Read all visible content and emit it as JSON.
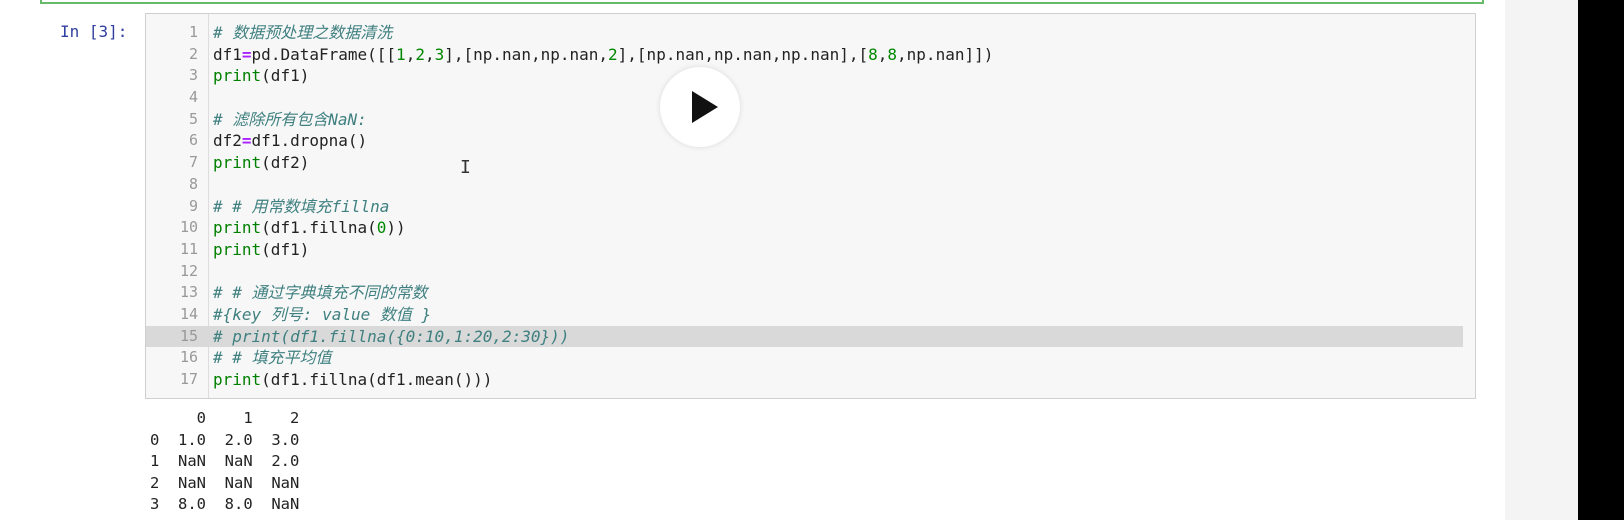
{
  "cell": {
    "prompt": "In [3]:",
    "collapse_glyph": "▾",
    "lines": [
      {
        "n": "1",
        "tokens": [
          {
            "t": "# 数据预处理之数据清洗",
            "c": "cm"
          }
        ]
      },
      {
        "n": "2",
        "tokens": [
          {
            "t": "df1",
            "c": ""
          },
          {
            "t": "=",
            "c": "op"
          },
          {
            "t": "pd.DataFrame([[",
            "c": ""
          },
          {
            "t": "1",
            "c": "num"
          },
          {
            "t": ",",
            "c": ""
          },
          {
            "t": "2",
            "c": "num"
          },
          {
            "t": ",",
            "c": ""
          },
          {
            "t": "3",
            "c": "num"
          },
          {
            "t": "],[np.nan,np.nan,",
            "c": ""
          },
          {
            "t": "2",
            "c": "num"
          },
          {
            "t": "],[np.nan,np.nan,np.nan],[",
            "c": ""
          },
          {
            "t": "8",
            "c": "num"
          },
          {
            "t": ",",
            "c": ""
          },
          {
            "t": "8",
            "c": "num"
          },
          {
            "t": ",np.nan]])",
            "c": ""
          }
        ]
      },
      {
        "n": "3",
        "tokens": [
          {
            "t": "print",
            "c": "kw"
          },
          {
            "t": "(df1)",
            "c": ""
          }
        ]
      },
      {
        "n": "4",
        "tokens": []
      },
      {
        "n": "5",
        "tokens": [
          {
            "t": "# 滤除所有包含NaN:",
            "c": "cm"
          }
        ]
      },
      {
        "n": "6",
        "tokens": [
          {
            "t": "df2",
            "c": ""
          },
          {
            "t": "=",
            "c": "op"
          },
          {
            "t": "df1.dropna()",
            "c": ""
          }
        ]
      },
      {
        "n": "7",
        "tokens": [
          {
            "t": "print",
            "c": "kw"
          },
          {
            "t": "(df2)",
            "c": ""
          }
        ]
      },
      {
        "n": "8",
        "tokens": []
      },
      {
        "n": "9",
        "tokens": [
          {
            "t": "# # 用常数填充fillna",
            "c": "cm"
          }
        ]
      },
      {
        "n": "10",
        "tokens": [
          {
            "t": "print",
            "c": "kw"
          },
          {
            "t": "(df1.fillna(",
            "c": ""
          },
          {
            "t": "0",
            "c": "num"
          },
          {
            "t": "))",
            "c": ""
          }
        ]
      },
      {
        "n": "11",
        "tokens": [
          {
            "t": "print",
            "c": "kw"
          },
          {
            "t": "(df1)",
            "c": ""
          }
        ]
      },
      {
        "n": "12",
        "tokens": []
      },
      {
        "n": "13",
        "tokens": [
          {
            "t": "# # 通过字典填充不同的常数",
            "c": "cm"
          }
        ]
      },
      {
        "n": "14",
        "tokens": [
          {
            "t": "#{key 列号: value 数值 }",
            "c": "cm"
          }
        ]
      },
      {
        "n": "15",
        "hl": true,
        "tokens": [
          {
            "t": "# print(df1.fillna({0:10,1:20,2:30}))",
            "c": "cm"
          }
        ]
      },
      {
        "n": "16",
        "tokens": [
          {
            "t": "# # 填充平均值",
            "c": "cm"
          }
        ]
      },
      {
        "n": "17",
        "tokens": [
          {
            "t": "print",
            "c": "kw"
          },
          {
            "t": "(df1.fillna(df1.mean()))",
            "c": ""
          }
        ]
      }
    ]
  },
  "output": {
    "rows": [
      "     0    1    2",
      "0  1.0  2.0  3.0",
      "1  NaN  NaN  2.0",
      "2  NaN  NaN  NaN",
      "3  8.0  8.0  NaN"
    ]
  },
  "overlay": {
    "play_icon": "play-icon",
    "cursor_glyph": "I"
  }
}
